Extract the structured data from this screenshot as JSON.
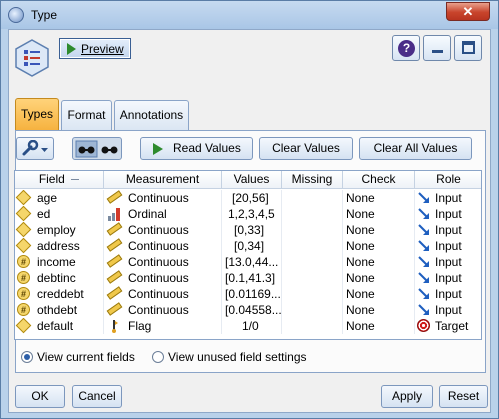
{
  "window": {
    "title": "Type"
  },
  "toolbar": {
    "preview_label": "Preview"
  },
  "tabs": [
    {
      "label": "Types",
      "active": true
    },
    {
      "label": "Format",
      "active": false
    },
    {
      "label": "Annotations",
      "active": false
    }
  ],
  "actions": {
    "read_values": "Read Values",
    "clear_values": "Clear Values",
    "clear_all_values": "Clear All Values"
  },
  "table": {
    "columns": [
      "Field",
      "Measurement",
      "Values",
      "Missing",
      "Check",
      "Role"
    ],
    "rows": [
      {
        "field": "age",
        "field_icon": "string-diamond-icon",
        "measurement": "Continuous",
        "measurement_icon": "ruler-icon",
        "values": "[20,56]",
        "missing": "",
        "check": "None",
        "role": "Input",
        "role_icon": "input-arrow-icon"
      },
      {
        "field": "ed",
        "field_icon": "string-diamond-icon",
        "measurement": "Ordinal",
        "measurement_icon": "bar-chart-icon",
        "values": "1,2,3,4,5",
        "missing": "",
        "check": "None",
        "role": "Input",
        "role_icon": "input-arrow-icon"
      },
      {
        "field": "employ",
        "field_icon": "string-diamond-icon",
        "measurement": "Continuous",
        "measurement_icon": "ruler-icon",
        "values": "[0,33]",
        "missing": "",
        "check": "None",
        "role": "Input",
        "role_icon": "input-arrow-icon"
      },
      {
        "field": "address",
        "field_icon": "string-diamond-icon",
        "measurement": "Continuous",
        "measurement_icon": "ruler-icon",
        "values": "[0,34]",
        "missing": "",
        "check": "None",
        "role": "Input",
        "role_icon": "input-arrow-icon"
      },
      {
        "field": "income",
        "field_icon": "numeric-hash-icon",
        "measurement": "Continuous",
        "measurement_icon": "ruler-icon",
        "values": "[13.0,44...",
        "missing": "",
        "check": "None",
        "role": "Input",
        "role_icon": "input-arrow-icon"
      },
      {
        "field": "debtinc",
        "field_icon": "numeric-hash-icon",
        "measurement": "Continuous",
        "measurement_icon": "ruler-icon",
        "values": "[0.1,41.3]",
        "missing": "",
        "check": "None",
        "role": "Input",
        "role_icon": "input-arrow-icon"
      },
      {
        "field": "creddebt",
        "field_icon": "numeric-hash-icon",
        "measurement": "Continuous",
        "measurement_icon": "ruler-icon",
        "values": "[0.01169...",
        "missing": "",
        "check": "None",
        "role": "Input",
        "role_icon": "input-arrow-icon"
      },
      {
        "field": "othdebt",
        "field_icon": "numeric-hash-icon",
        "measurement": "Continuous",
        "measurement_icon": "ruler-icon",
        "values": "[0.04558...",
        "missing": "",
        "check": "None",
        "role": "Input",
        "role_icon": "input-arrow-icon"
      },
      {
        "field": "default",
        "field_icon": "string-diamond-icon",
        "measurement": "Flag",
        "measurement_icon": "flag-icon",
        "values": "1/0",
        "missing": "",
        "check": "None",
        "role": "Target",
        "role_icon": "target-icon"
      }
    ]
  },
  "view_options": {
    "current": "View current fields",
    "unused": "View unused field settings",
    "selected": "current"
  },
  "buttons": {
    "ok": "OK",
    "cancel": "Cancel",
    "apply": "Apply",
    "reset": "Reset"
  },
  "colors": {
    "active_tab": "#f6b23f",
    "frame": "#b9d1ea",
    "target": "#d21f1f"
  }
}
